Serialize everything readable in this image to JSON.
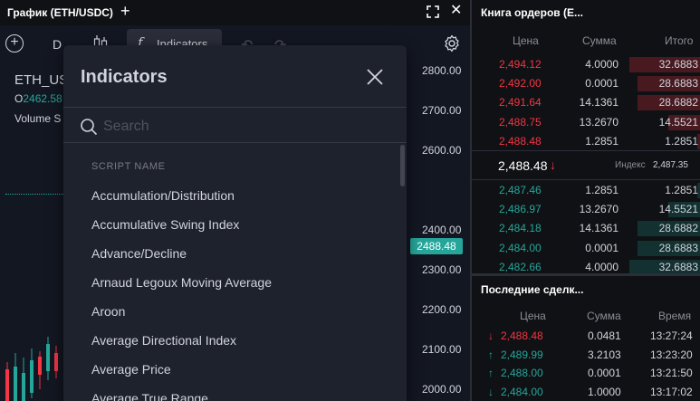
{
  "chart": {
    "tab_title": "График (ETH/USDC)",
    "add_tab": "+",
    "toolbar": {
      "interval": "D",
      "indicators_label": "Indicators",
      "fx_glyph": "f",
      "undo_glyph": "↶",
      "redo_glyph": "↷"
    },
    "symbol": "ETH_US",
    "ohlc_prefix": "O",
    "ohlc_value": "2462.58",
    "volume_label": "Volume S",
    "price_ticks": [
      "2800.00",
      "2700.00",
      "2600.00",
      "2400.00",
      "2300.00",
      "2200.00",
      "2100.00",
      "2000.00"
    ],
    "current_price": "2488.48"
  },
  "indicators_dialog": {
    "title": "Indicators",
    "search_placeholder": "Search",
    "column_header": "SCRIPT NAME",
    "items": [
      "Accumulation/Distribution",
      "Accumulative Swing Index",
      "Advance/Decline",
      "Arnaud Legoux Moving Average",
      "Aroon",
      "Average Directional Index",
      "Average Price",
      "Average True Range"
    ]
  },
  "order_book": {
    "title": "Книга ордеров (E...",
    "headers": {
      "price": "Цена",
      "amount": "Сумма",
      "total": "Итого"
    },
    "asks": [
      {
        "price": "2,494.12",
        "amount": "4.0000",
        "total": "32.6883",
        "depth": 1.0
      },
      {
        "price": "2,492.00",
        "amount": "0.0001",
        "total": "28.6883",
        "depth": 0.88
      },
      {
        "price": "2,491.64",
        "amount": "14.1361",
        "total": "28.6882",
        "depth": 0.88
      },
      {
        "price": "2,488.75",
        "amount": "13.2670",
        "total": "14.5521",
        "depth": 0.45
      },
      {
        "price": "2,488.48",
        "amount": "1.2851",
        "total": "1.2851",
        "depth": 0.04
      }
    ],
    "last_price": "2,488.48",
    "last_arrow": "↓",
    "index_label": "Индекс",
    "index_value": "2,487.35",
    "bids": [
      {
        "price": "2,487.46",
        "amount": "1.2851",
        "total": "1.2851",
        "depth": 0.04
      },
      {
        "price": "2,486.97",
        "amount": "13.2670",
        "total": "14.5521",
        "depth": 0.45
      },
      {
        "price": "2,484.18",
        "amount": "14.1361",
        "total": "28.6882",
        "depth": 0.88
      },
      {
        "price": "2,484.00",
        "amount": "0.0001",
        "total": "28.6883",
        "depth": 0.88
      },
      {
        "price": "2,482.66",
        "amount": "4.0000",
        "total": "32.6883",
        "depth": 1.0
      }
    ]
  },
  "recent_trades": {
    "title": "Последние сделк...",
    "headers": {
      "price": "Цена",
      "amount": "Сумма",
      "time": "Время"
    },
    "rows": [
      {
        "dir": "down",
        "arrow": "↓",
        "price": "2,488.48",
        "amount": "0.0481",
        "time": "13:27:24"
      },
      {
        "dir": "up",
        "arrow": "↑",
        "price": "2,489.99",
        "amount": "3.2103",
        "time": "13:23:20"
      },
      {
        "dir": "up",
        "arrow": "↑",
        "price": "2,488.00",
        "amount": "0.0001",
        "time": "13:21:50"
      },
      {
        "dir": "up",
        "arrow": "↓",
        "price": "2,484.00",
        "amount": "1.0000",
        "time": "13:17:02"
      }
    ]
  },
  "colors": {
    "up": "#26a69a",
    "down": "#f23645",
    "accent": "#26a69a"
  }
}
